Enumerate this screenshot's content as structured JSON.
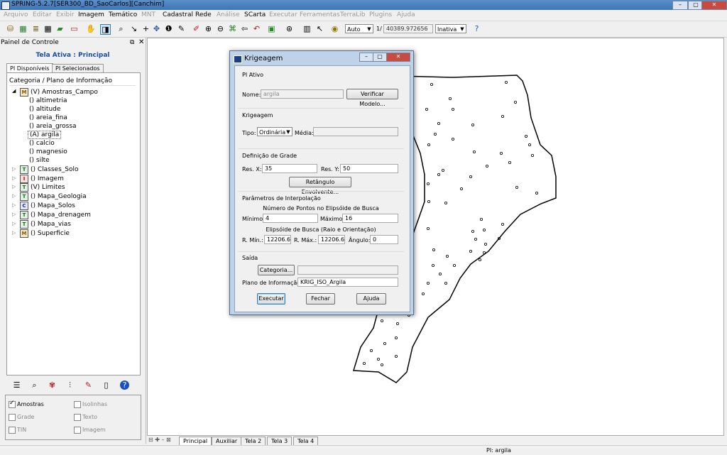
{
  "window": {
    "title": "SPRING-5.2.7[SER300_BD_SaoCarlos][Canchim]"
  },
  "menu": {
    "items": [
      {
        "label": "Arquivo",
        "enabled": false
      },
      {
        "label": "Editar",
        "enabled": false
      },
      {
        "label": "Exibir",
        "enabled": false
      },
      {
        "label": "Imagem",
        "enabled": true
      },
      {
        "label": "Temático",
        "enabled": true
      },
      {
        "label": "MNT",
        "enabled": false
      },
      {
        "label": "Cadastral",
        "enabled": true
      },
      {
        "label": "Rede",
        "enabled": true
      },
      {
        "label": "Análise",
        "enabled": false
      },
      {
        "label": "SCarta",
        "enabled": true
      },
      {
        "label": "Executar",
        "enabled": false
      },
      {
        "label": "Ferramentas",
        "enabled": false
      },
      {
        "label": "TerraLib",
        "enabled": false
      },
      {
        "label": "Plugins",
        "enabled": false
      },
      {
        "label": "Ajuda",
        "enabled": false
      }
    ]
  },
  "toolbar": {
    "scale_mode": "Auto",
    "scale_prefix": "1/",
    "scale_value": "40389.972656",
    "state": "Inativa"
  },
  "panel": {
    "title": "Painel de Controle",
    "active_screen": "Tela Ativa : Principal",
    "tabs": [
      "PI Disponíveis",
      "PI Selecionados"
    ],
    "tree_header": "Categoria / Plano de Informação",
    "tree": [
      {
        "label": "(V) Amostras_Campo",
        "badge": "M",
        "expanded": true
      },
      {
        "label": "() altimetria",
        "child": true
      },
      {
        "label": "() altitude",
        "child": true
      },
      {
        "label": "() areia_fina",
        "child": true
      },
      {
        "label": "() areia_grossa",
        "child": true
      },
      {
        "label": "(A) argila",
        "child": true
      },
      {
        "label": "() calcio",
        "child": true
      },
      {
        "label": "() magnesio",
        "child": true
      },
      {
        "label": "() silte",
        "child": true
      },
      {
        "label": "() Classes_Solo",
        "badge": "T"
      },
      {
        "label": "() Imagem",
        "badge": "I"
      },
      {
        "label": "(V) Limites",
        "badge": "T"
      },
      {
        "label": "() Mapa_Geologia",
        "badge": "T"
      },
      {
        "label": "() Mapa_Solos",
        "badge": "C"
      },
      {
        "label": "() Mapa_drenagem",
        "badge": "T"
      },
      {
        "label": "() Mapa_vias",
        "badge": "T"
      },
      {
        "label": "() Superficie",
        "badge": "M"
      }
    ],
    "options": [
      {
        "label": "Amostras",
        "checked": true,
        "enabled": true
      },
      {
        "label": "Isolinhas",
        "checked": false,
        "enabled": false
      },
      {
        "label": "Grade",
        "checked": false,
        "enabled": false
      },
      {
        "label": "Texto",
        "checked": false,
        "enabled": false
      },
      {
        "label": "TIN",
        "checked": false,
        "enabled": false
      },
      {
        "label": "Imagem",
        "checked": false,
        "enabled": false
      }
    ]
  },
  "bottom_tabs": [
    "Principal",
    "Auxiliar",
    "Tela 2",
    "Tela 3",
    "Tela 4"
  ],
  "status": {
    "text": "PI: argila"
  },
  "dialog": {
    "title": "Krigeagem",
    "pi_ativo": {
      "section": "PI Ativo",
      "nome_label": "Nome:",
      "nome_value": "argila",
      "verify_button": "Verificar Modelo..."
    },
    "krigeagem": {
      "section": "Krigeagem",
      "tipo_label": "Tipo:",
      "tipo_value": "Ordinária",
      "media_label": "Média:",
      "media_value": ""
    },
    "grade": {
      "section": "Definição de Grade",
      "resx_label": "Res. X:",
      "resx_value": "35",
      "resy_label": "Res. Y:",
      "resy_value": "50",
      "rect_button": "Retângulo Envolvente..."
    },
    "interp": {
      "section": "Parâmetros de Interpolação",
      "points_caption": "Número de Pontos no Elipsóide de Busca",
      "min_label": "Mínimo:",
      "min_value": "4",
      "max_label": "Máximo:",
      "max_value": "16",
      "ellipse_caption": "Elipsóide de Busca (Raio e Orientação)",
      "rmin_label": "R. Mín.:",
      "rmin_value": "12206.6",
      "rmax_label": "R. Máx.:",
      "rmax_value": "12206.6",
      "angle_label": "Ângulo:",
      "angle_value": "0"
    },
    "saida": {
      "section": "Saída",
      "category_button": "Categoria...",
      "category_value": "",
      "pi_label": "Plano de Informação:",
      "pi_value": "KRIG_ISO_Argila"
    },
    "buttons": {
      "execute": "Executar",
      "close": "Fechar",
      "help": "Ajuda"
    }
  }
}
